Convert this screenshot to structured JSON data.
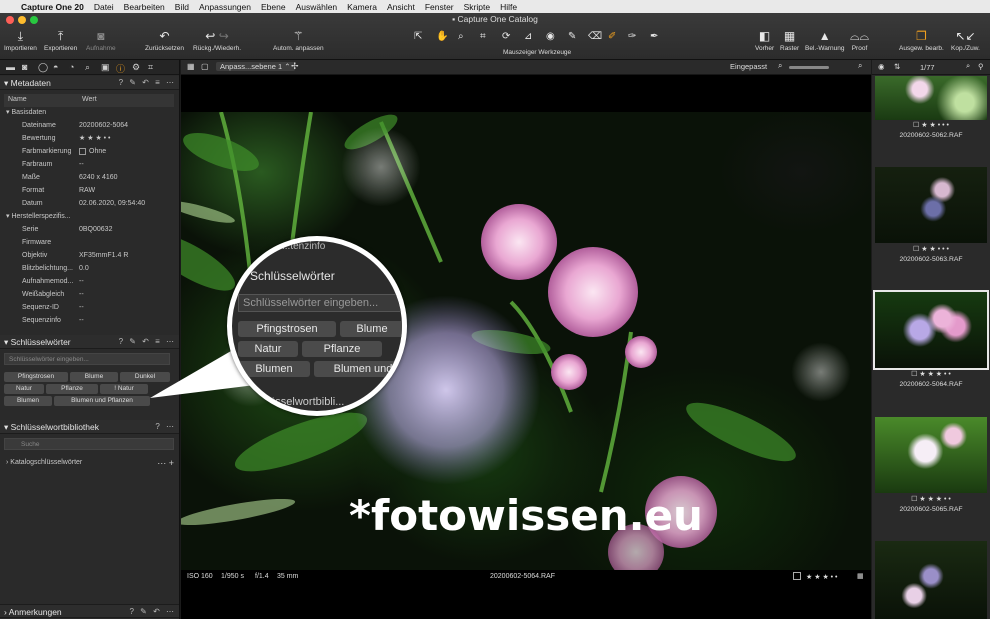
{
  "menubar": {
    "app": "Capture One 20",
    "items": [
      "Datei",
      "Bearbeiten",
      "Bild",
      "Anpassungen",
      "Ebene",
      "Auswählen",
      "Kamera",
      "Ansicht",
      "Fenster",
      "Skripte",
      "Hilfe"
    ]
  },
  "window": {
    "title": "Capture One Catalog"
  },
  "toolbar": {
    "import": "Importieren",
    "export": "Exportieren",
    "capture": "Aufnahme",
    "reset": "Zurücksetzen",
    "undo_redo": "Rückg./Wiederh.",
    "auto_adjust": "Autom. anpassen",
    "cursor_tools": "Mauszeiger Werkzeuge",
    "before": "Vorher",
    "grid": "Raster",
    "exposure_warning": "Bel.-Warnung",
    "proof": "Proof",
    "edit_selected": "Ausgew. bearb.",
    "copy_apply": "Kop./Zuw."
  },
  "metadata": {
    "title": "Metadaten",
    "col_name": "Name",
    "col_value": "Wert",
    "group_basic": "Basisdaten",
    "group_maker": "Herstellerspezifis...",
    "rows_basic": [
      {
        "k": "Dateiname",
        "v": "20200602-5064"
      },
      {
        "k": "Bewertung",
        "v": "★ ★ ★ • •"
      },
      {
        "k": "Farbmarkierung",
        "v": "Ohne"
      },
      {
        "k": "Farbraum",
        "v": "--"
      },
      {
        "k": "Maße",
        "v": "6240 x 4160"
      },
      {
        "k": "Format",
        "v": "RAW"
      },
      {
        "k": "Datum",
        "v": "02.06.2020, 09:54:40"
      }
    ],
    "rows_maker": [
      {
        "k": "Serie",
        "v": "0BQ00632"
      },
      {
        "k": "Firmware",
        "v": ""
      },
      {
        "k": "Objektiv",
        "v": "XF35mmF1.4 R"
      },
      {
        "k": "Blitzbelichtung...",
        "v": "0.0"
      },
      {
        "k": "Aufnahmemod...",
        "v": "--"
      },
      {
        "k": "Weißabgleich",
        "v": "--"
      },
      {
        "k": "Sequenz-ID",
        "v": "--"
      },
      {
        "k": "Sequenzinfo",
        "v": "--"
      }
    ]
  },
  "keywords": {
    "title": "Schlüsselwörter",
    "placeholder": "Schlüsselwörter eingeben...",
    "tags": [
      "Pfingstrosen",
      "Blume",
      "Dunkel",
      "Natur",
      "Pflanze",
      "! Natur",
      "Blumen",
      "Blumen und Pflanzen"
    ]
  },
  "library": {
    "title": "Schlüsselwortbibliothek",
    "search_placeholder": "Suche",
    "catalog_keywords": "Katalogschlüsselwörter"
  },
  "notes": {
    "title": "Anmerkungen"
  },
  "viewer": {
    "preset": "Anpass...sebene 1",
    "fit": "Eingepasst",
    "iso": "ISO 160",
    "shutter": "1/950 s",
    "aperture": "f/1.4",
    "focal": "35 mm",
    "filename": "20200602-5064.RAF",
    "rating": "★ ★ ★ • •",
    "watermark": "*fotowissen.eu"
  },
  "magnifier": {
    "header_partial": "...tenzinfo",
    "title": "Schlüsselwörter",
    "placeholder": "Schlüsselwörter eingeben...",
    "tags": [
      "Pfingstrosen",
      "Blume",
      "Natur",
      "Pflanze",
      "Blumen",
      "Blumen und"
    ],
    "footer_partial": "...üsselwortbibli..."
  },
  "filmstrip": {
    "counter": "1/77",
    "items": [
      {
        "name": "20200602-5062.RAF",
        "rating": "★ ★ • • •"
      },
      {
        "name": "20200602-5063.RAF",
        "rating": "★ ★ • • •"
      },
      {
        "name": "20200602-5064.RAF",
        "rating": "★ ★ ★ • •"
      },
      {
        "name": "20200602-5065.RAF",
        "rating": "★ ★ ★ • •"
      }
    ]
  },
  "colors": {
    "accent_orange": "#f0a020",
    "panel": "#2a2a2a",
    "background": "#1b1b1b"
  },
  "icons": [
    "apple-icon",
    "import-icon",
    "export-icon",
    "camera-icon",
    "reset-icon",
    "undo-icon",
    "redo-icon",
    "wand-icon",
    "cursor-tools-icons",
    "before-after-icon",
    "grid-icon",
    "warning-icon",
    "glasses-icon",
    "edit-selected-icon",
    "copy-apply-icon",
    "zoom-icon",
    "star-icon"
  ]
}
